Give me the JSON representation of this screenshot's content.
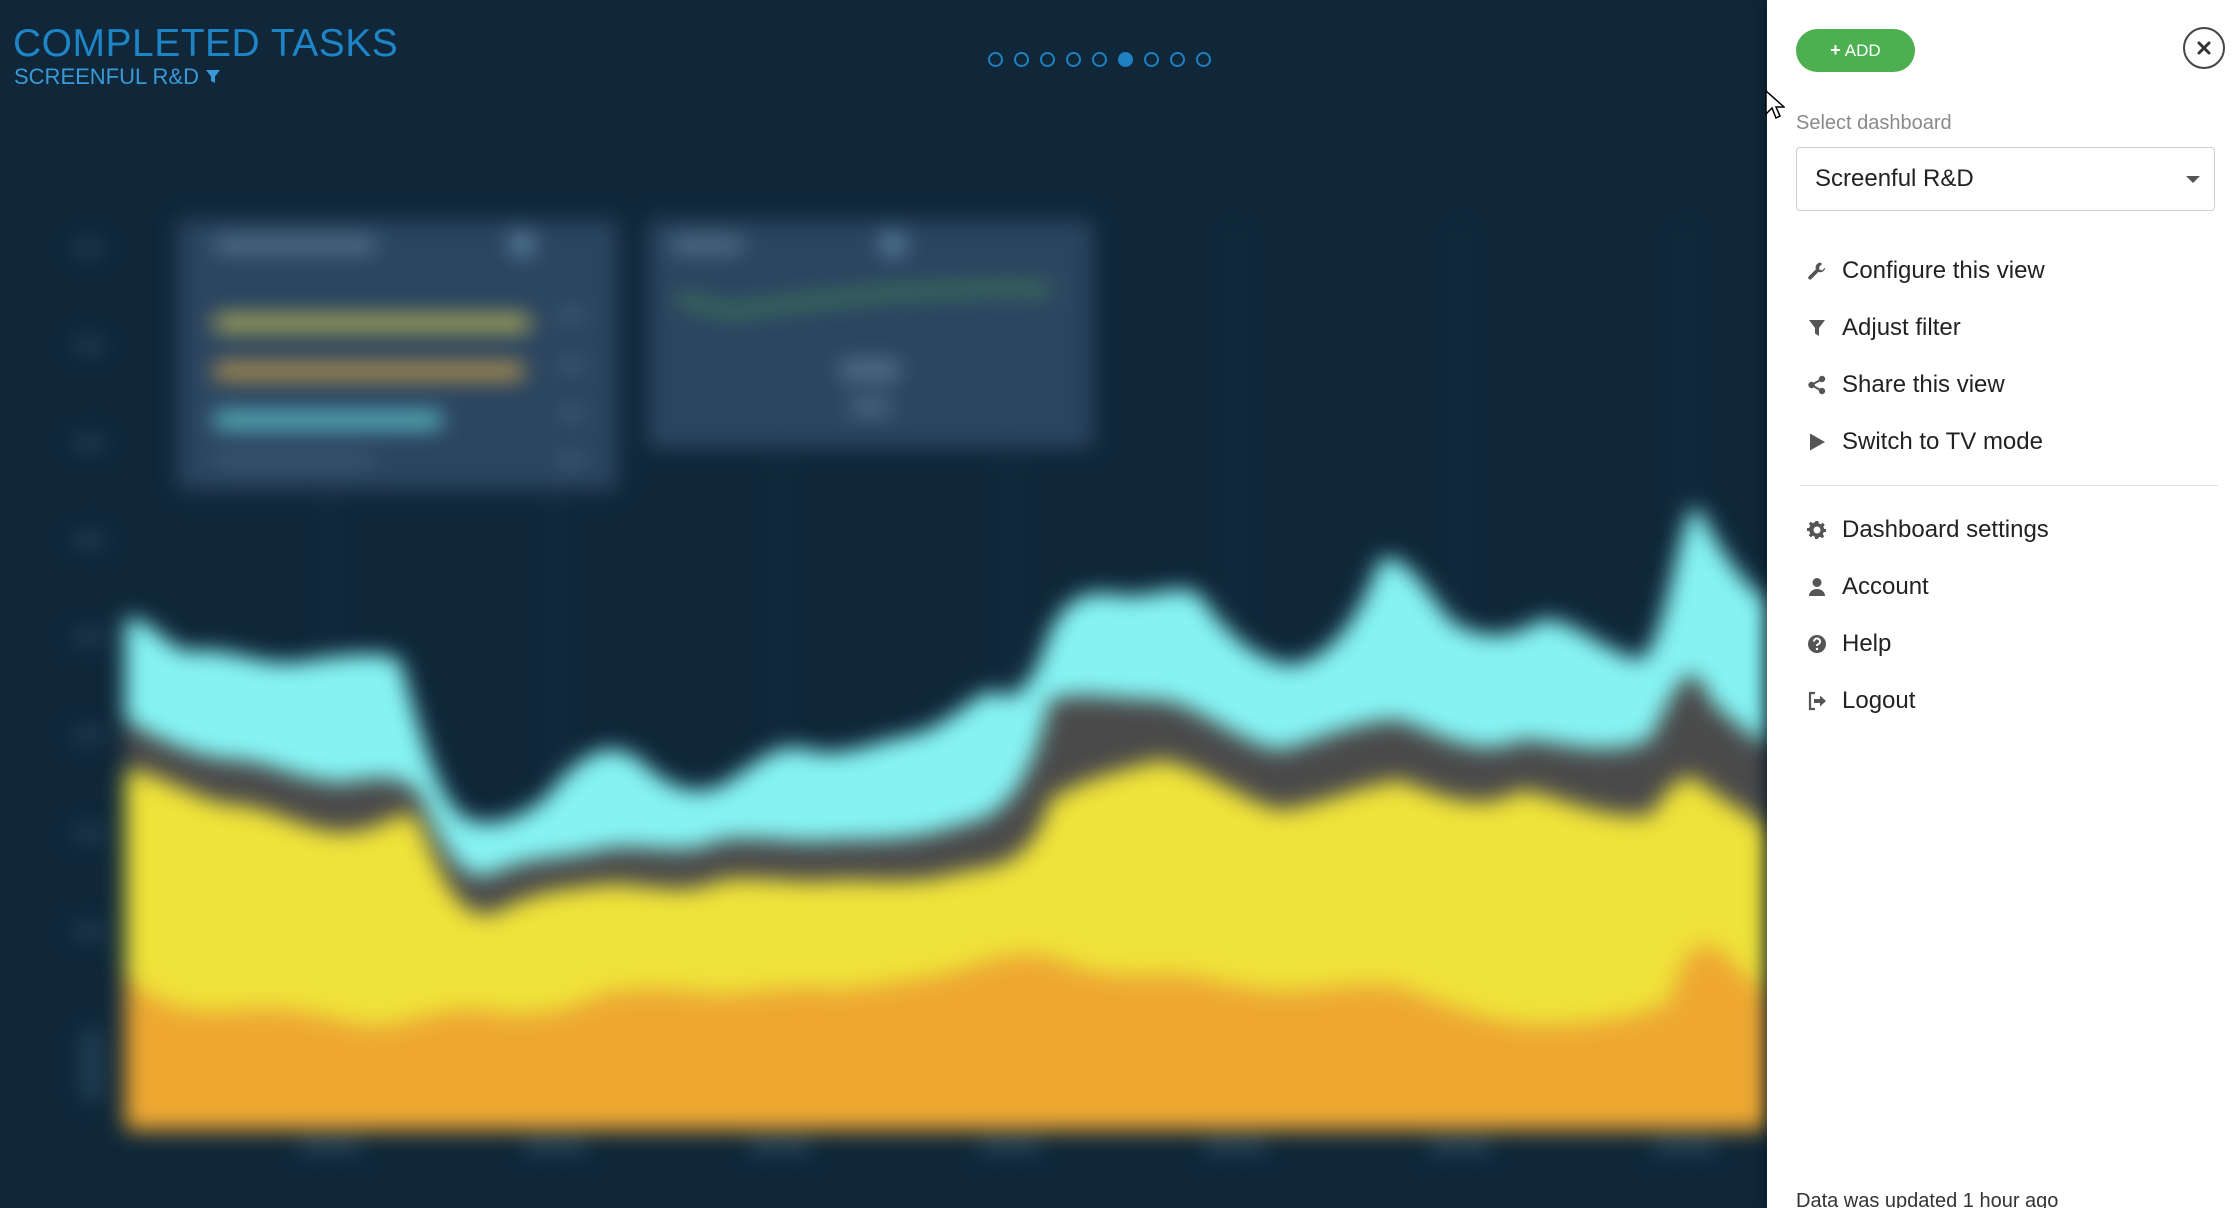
{
  "header": {
    "title": "COMPLETED TASKS",
    "subtitle": "SCREENFUL R&D"
  },
  "pager": {
    "count": 9,
    "active_index": 5
  },
  "panel": {
    "add_label": "ADD",
    "select_label": "Select dashboard",
    "selected_dashboard": "Screenful R&D",
    "menu_primary": [
      {
        "icon": "wrench-icon",
        "label": "Configure this view"
      },
      {
        "icon": "filter-icon",
        "label": "Adjust filter"
      },
      {
        "icon": "share-icon",
        "label": "Share this view"
      },
      {
        "icon": "play-icon",
        "label": "Switch to TV mode"
      }
    ],
    "menu_secondary": [
      {
        "icon": "gear-icon",
        "label": "Dashboard settings"
      },
      {
        "icon": "user-icon",
        "label": "Account"
      },
      {
        "icon": "help-icon",
        "label": "Help"
      },
      {
        "icon": "logout-icon",
        "label": "Logout"
      }
    ],
    "footer": "Data was updated 1 hour ago"
  },
  "colors": {
    "accent": "#1e84c6",
    "add_button": "#4caf50",
    "series_cyan": "#86f3f3",
    "series_gray": "#4a4a4a",
    "series_yellow": "#efe23a",
    "series_orange": "#eea832"
  }
}
